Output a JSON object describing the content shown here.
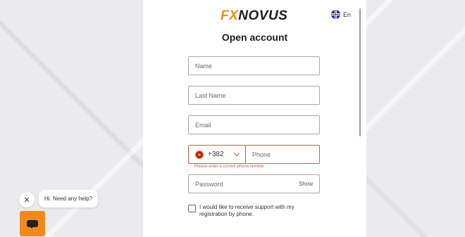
{
  "brand": {
    "fx": "FX",
    "novus": "NOVUS"
  },
  "language": {
    "label": "En",
    "flag_icon": "uk-flag-icon"
  },
  "title": "Open account",
  "form": {
    "name_placeholder": "Name",
    "lastname_placeholder": "Last Name",
    "email_placeholder": "Email",
    "phone": {
      "country_code": "+382",
      "country_flag_icon": "montenegro-flag-icon",
      "placeholder": "Phone",
      "error": "Please enter a correct phone number"
    },
    "password_placeholder": "Password",
    "password_show_label": "Show",
    "consent_label": "I would like to receive support with my registration by phone."
  },
  "chat": {
    "bubble_text": "Hi. Need any help?",
    "close_icon": "close-icon",
    "launcher_icon": "chat-icon"
  },
  "colors": {
    "accent": "#f08a1c",
    "error": "#d9534f",
    "panel": "#ffffff"
  }
}
